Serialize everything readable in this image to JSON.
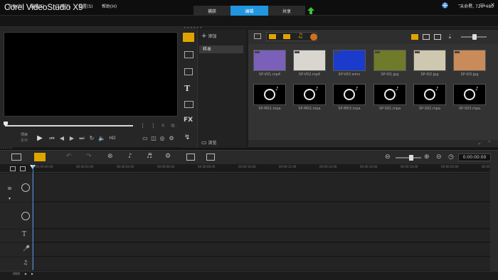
{
  "app": {
    "title": "Corel VideoStudio X9"
  },
  "steps": {
    "capture": "捕获",
    "edit": "编辑",
    "share": "共享"
  },
  "menu": {
    "file": "文件(F)",
    "edit": "编辑(E)",
    "tools": "工具(T)",
    "settings": "设置(S)",
    "help": "帮助(H)"
  },
  "project_info": "未命名, 720*480",
  "player": {
    "mode_project": "项目",
    "mode_clip": "素材",
    "hd_label": "HD"
  },
  "library": {
    "add_label": "添加",
    "folder": "样本",
    "browse_label": "浏览",
    "items": [
      {
        "name": "SP-V01.mp4",
        "kind": "video",
        "color": "#7a60b8"
      },
      {
        "name": "SP-V02.mp4",
        "kind": "video",
        "color": "#d9d6cf"
      },
      {
        "name": "SP-V03.wmv",
        "kind": "video",
        "color": "#1a3bcc"
      },
      {
        "name": "SP-I01.jpg",
        "kind": "image",
        "color": "#6f7a2a"
      },
      {
        "name": "SP-I02.jpg",
        "kind": "image",
        "color": "#cfc8b0"
      },
      {
        "name": "SP-I03.jpg",
        "kind": "image",
        "color": "#c98b5a"
      },
      {
        "name": "SP-M01.mpa",
        "kind": "audio",
        "color": "#000000"
      },
      {
        "name": "SP-M02.mpa",
        "kind": "audio",
        "color": "#000000"
      },
      {
        "name": "SP-M03.mpa",
        "kind": "audio",
        "color": "#000000"
      },
      {
        "name": "SP-S01.mpa",
        "kind": "audio",
        "color": "#000000"
      },
      {
        "name": "SP-S02.mpa",
        "kind": "audio",
        "color": "#000000"
      },
      {
        "name": "SP-S03.mpa",
        "kind": "audio",
        "color": "#000000"
      }
    ]
  },
  "timeline": {
    "timecode": "0:00:00:00",
    "ruler": [
      "00:00:00:00",
      "00:00:02:00",
      "00:00:04:00",
      "00:00:06:00",
      "00:00:08:00",
      "00:00:10:00",
      "00:00:12:00",
      "00:00:14:00",
      "00:00:16:00",
      "00:00:18:00",
      "00:00:20:00",
      "00:00:22:00"
    ],
    "fx_label": "FX"
  },
  "colors": {
    "accent": "#2196e0",
    "upload": "#3cc23c",
    "globe": "#4a90e2"
  }
}
